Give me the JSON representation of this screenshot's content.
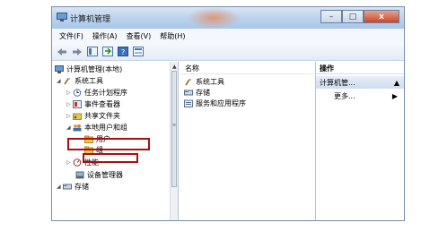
{
  "window": {
    "title": "计算机管理",
    "minimize": "–",
    "maximize": "□",
    "close": "x"
  },
  "menu": [
    "文件(F)",
    "操作(A)",
    "查看(V)",
    "帮助(H)"
  ],
  "toolbar": [
    {
      "icon": "back-arrow-icon"
    },
    {
      "icon": "forward-arrow-icon"
    },
    {
      "icon": "console-tree-icon"
    },
    {
      "icon": "export-icon"
    },
    {
      "icon": "help-icon"
    },
    {
      "icon": "properties-icon"
    }
  ],
  "tree": {
    "root": "计算机管理(本地)",
    "system_tools": "系统工具",
    "task_scheduler": "任务计划程序",
    "event_viewer": "事件查看器",
    "shared_folders": "共享文件夹",
    "local_users": "本地用户和组",
    "users": "用户",
    "groups": "组",
    "performance": "性能",
    "device_manager": "设备管理器",
    "storage": "存储"
  },
  "list": {
    "header": "名称",
    "items": [
      "系统工具",
      "存储",
      "服务和应用程序"
    ]
  },
  "actions": {
    "header": "操作",
    "selected": "计算机管...",
    "more": "更多..."
  },
  "colors": {
    "highlight": "#a80f12",
    "folder": "#f0c64a",
    "titlebar": "#bcd3ee"
  }
}
